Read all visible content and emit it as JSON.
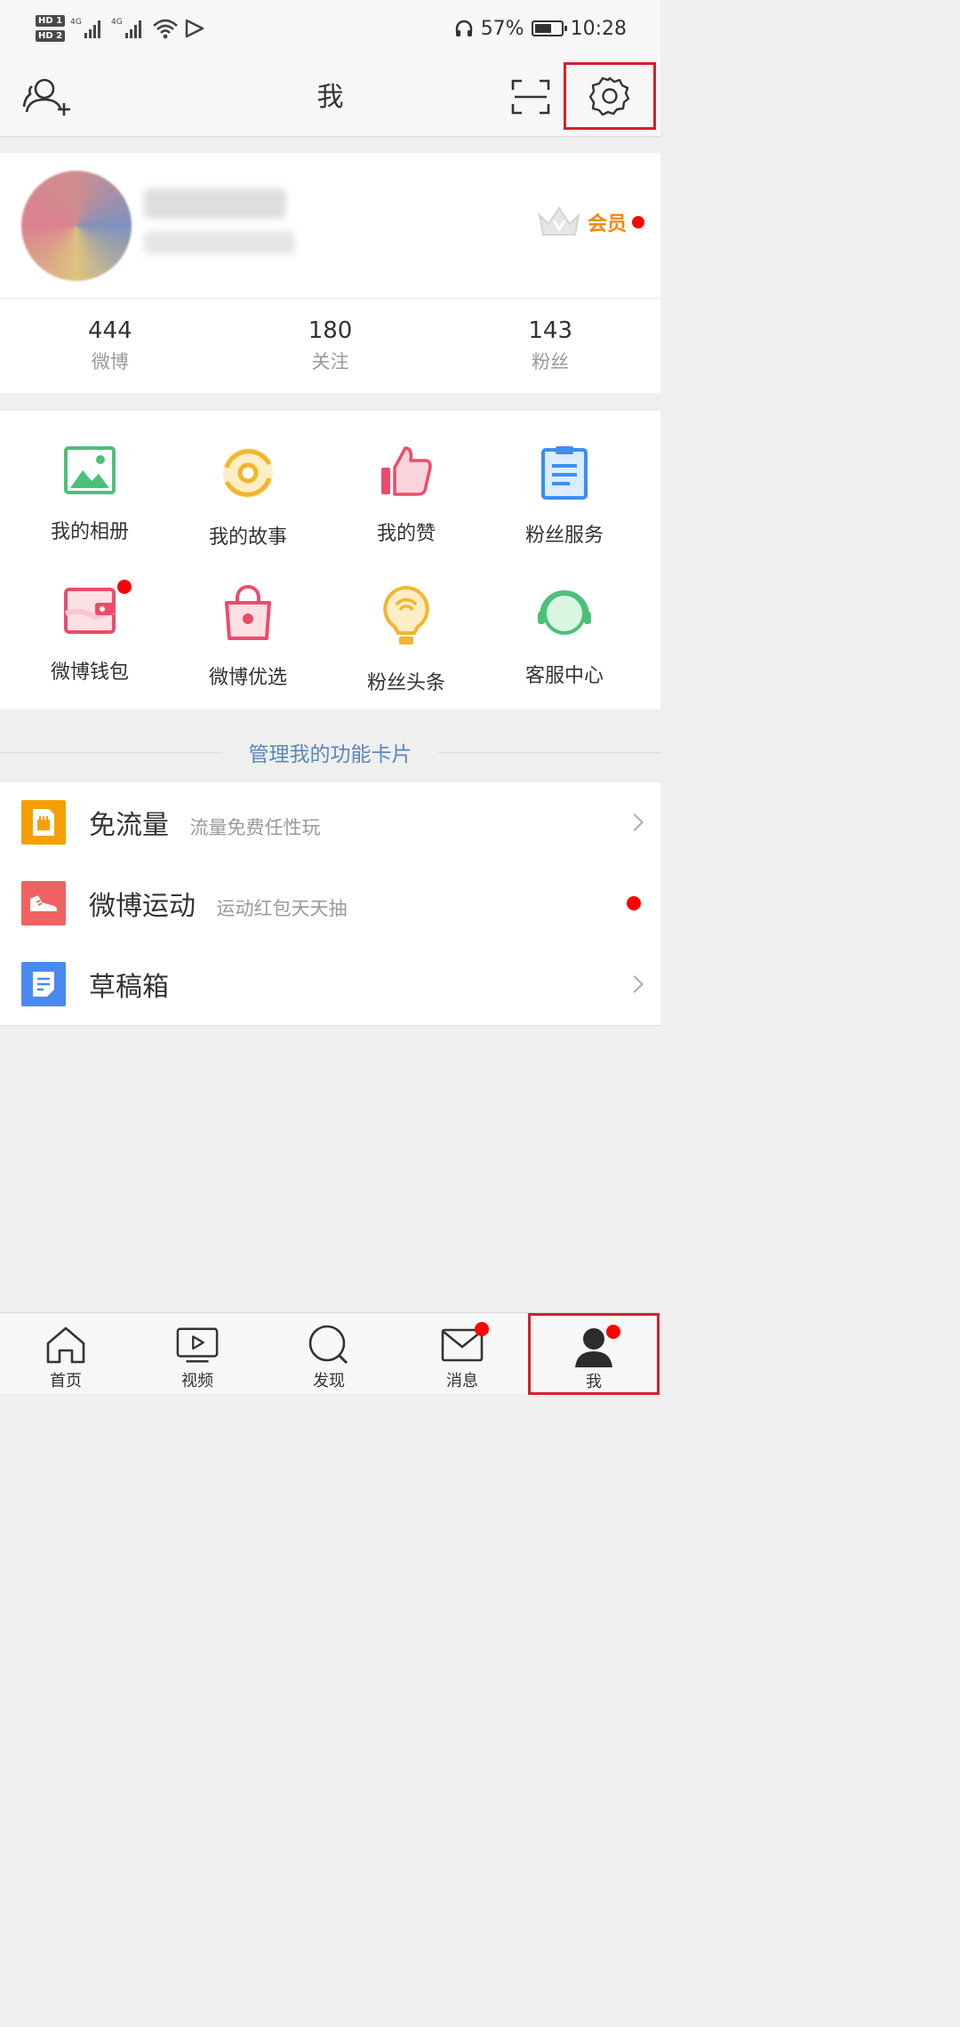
{
  "status_bar": {
    "sim1": "HD 1",
    "sim2": "HD 2",
    "net1": "4G",
    "net2": "4G",
    "battery": "57%",
    "time": "10:28"
  },
  "header": {
    "title": "我",
    "icons": [
      "add-user-icon",
      "scan-icon",
      "gear-icon"
    ]
  },
  "profile": {
    "vip_label": "会员",
    "stats": [
      {
        "num": "444",
        "label": "微博"
      },
      {
        "num": "180",
        "label": "关注"
      },
      {
        "num": "143",
        "label": "粉丝"
      }
    ]
  },
  "features": [
    {
      "label": "我的相册",
      "icon": "album-icon"
    },
    {
      "label": "我的故事",
      "icon": "story-icon"
    },
    {
      "label": "我的赞",
      "icon": "thumbs-up-icon"
    },
    {
      "label": "粉丝服务",
      "icon": "clipboard-icon"
    },
    {
      "label": "微博钱包",
      "icon": "wallet-icon",
      "badge": true
    },
    {
      "label": "微博优选",
      "icon": "shopping-bag-icon"
    },
    {
      "label": "粉丝头条",
      "icon": "bulb-icon"
    },
    {
      "label": "客服中心",
      "icon": "headset-icon"
    }
  ],
  "manage_cards": "管理我的功能卡片",
  "list": [
    {
      "title": "免流量",
      "subtitle": "流量免费任性玩",
      "icon": "sim-card-icon",
      "color": "#f5a000"
    },
    {
      "title": "微博运动",
      "subtitle": "运动红包天天抽",
      "icon": "sneaker-icon",
      "color": "#f06262"
    },
    {
      "title": "草稿箱",
      "subtitle": "",
      "icon": "draft-icon",
      "color": "#4a8af0"
    }
  ],
  "tabs": [
    {
      "label": "首页",
      "icon": "home-icon"
    },
    {
      "label": "视频",
      "icon": "video-icon"
    },
    {
      "label": "发现",
      "icon": "search-icon"
    },
    {
      "label": "消息",
      "icon": "mail-icon",
      "badge": true
    },
    {
      "label": "我",
      "icon": "user-icon",
      "badge": true
    }
  ],
  "colors": {
    "accent_red": "#d6202c",
    "badge_red": "#ff0000",
    "vip_orange": "#f08a00",
    "link_blue": "#5b87b8"
  }
}
